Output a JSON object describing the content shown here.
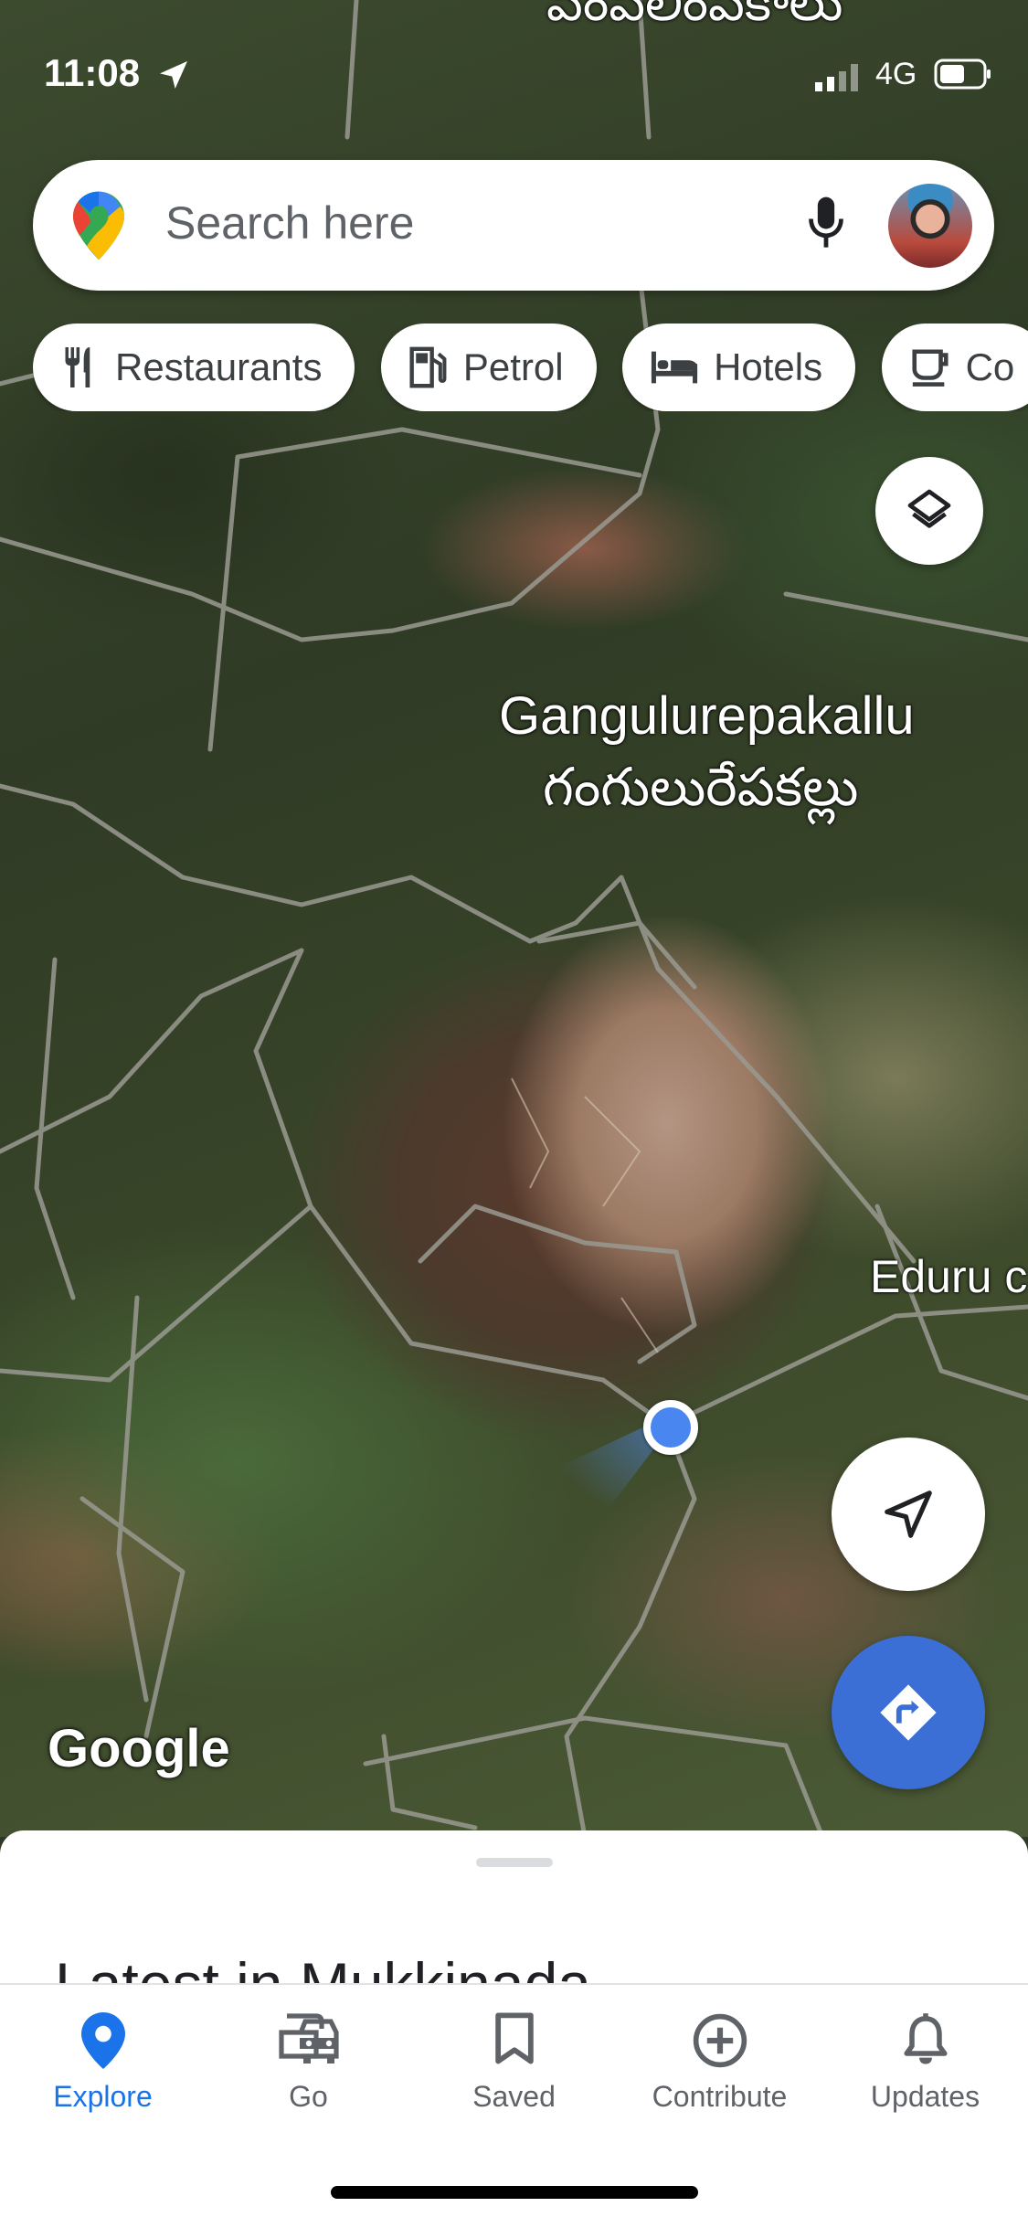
{
  "status_bar": {
    "time": "11:08",
    "network": "4G"
  },
  "search": {
    "placeholder": "Search here"
  },
  "chips": [
    {
      "label": "Restaurants",
      "icon": "fork-knife-icon"
    },
    {
      "label": "Petrol",
      "icon": "fuel-pump-icon"
    },
    {
      "label": "Hotels",
      "icon": "bed-icon"
    },
    {
      "label": "Co",
      "icon": "coffee-icon"
    }
  ],
  "map": {
    "top_label": "పెంపలింపకాలు",
    "place_name_en": "Gangulurepakallu",
    "place_name_te": "గంగులురేపకల్లు",
    "side_label": "Eduru c",
    "brand": "Google"
  },
  "sheet": {
    "heading": "Latest in Mukkinada"
  },
  "nav": {
    "tabs": [
      {
        "label": "Explore",
        "icon": "location-pin-icon",
        "active": true
      },
      {
        "label": "Go",
        "icon": "car-icon",
        "active": false
      },
      {
        "label": "Saved",
        "icon": "bookmark-icon",
        "active": false
      },
      {
        "label": "Contribute",
        "icon": "add-circle-icon",
        "active": false
      },
      {
        "label": "Updates",
        "icon": "bell-icon",
        "active": false
      }
    ]
  },
  "colors": {
    "accent": "#1a73e8",
    "directions_fab": "#3b6fd6",
    "location_dot": "#4a86f0"
  }
}
